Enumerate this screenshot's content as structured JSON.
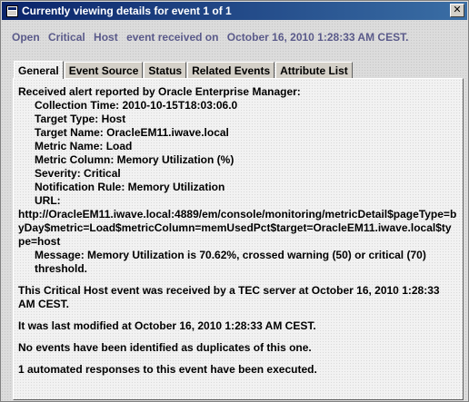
{
  "window": {
    "title": "Currently viewing details for event 1 of 1",
    "close_label": "✕"
  },
  "summary": {
    "status": "Open",
    "severity": "Critical",
    "class": "Host",
    "received_label": "event received on",
    "received_time": "October 16, 2010 1:28:33 AM CEST."
  },
  "tabs": [
    {
      "label": "General",
      "active": true
    },
    {
      "label": "Event Source",
      "active": false
    },
    {
      "label": "Status",
      "active": false
    },
    {
      "label": "Related Events",
      "active": false
    },
    {
      "label": "Attribute List",
      "active": false
    }
  ],
  "general": {
    "intro": "Received alert reported by Oracle Enterprise Manager:",
    "details": [
      "Collection Time: 2010-10-15T18:03:06.0",
      "Target Type: Host",
      "Target Name: OracleEM11.iwave.local",
      "Metric Name: Load",
      "Metric Column: Memory Utilization (%)",
      "Severity: Critical",
      "Notification Rule: Memory Utilization",
      "URL:"
    ],
    "url": "http://OracleEM11.iwave.local:4889/em/console/monitoring/metricDetail$pageType=byDay$metric=Load$metricColumn=memUsedPct$target=OracleEM11.iwave.local$type=host",
    "message": "Message: Memory Utilization is 70.62%, crossed warning (50) or critical (70) threshold.",
    "paragraphs": [
      "This Critical Host event was received by a TEC server at October 16, 2010 1:28:33 AM CEST.",
      "It was last modified at October 16, 2010 1:28:33 AM CEST.",
      "No events have been identified as duplicates of this one.",
      "1 automated responses to this event have been executed."
    ]
  }
}
